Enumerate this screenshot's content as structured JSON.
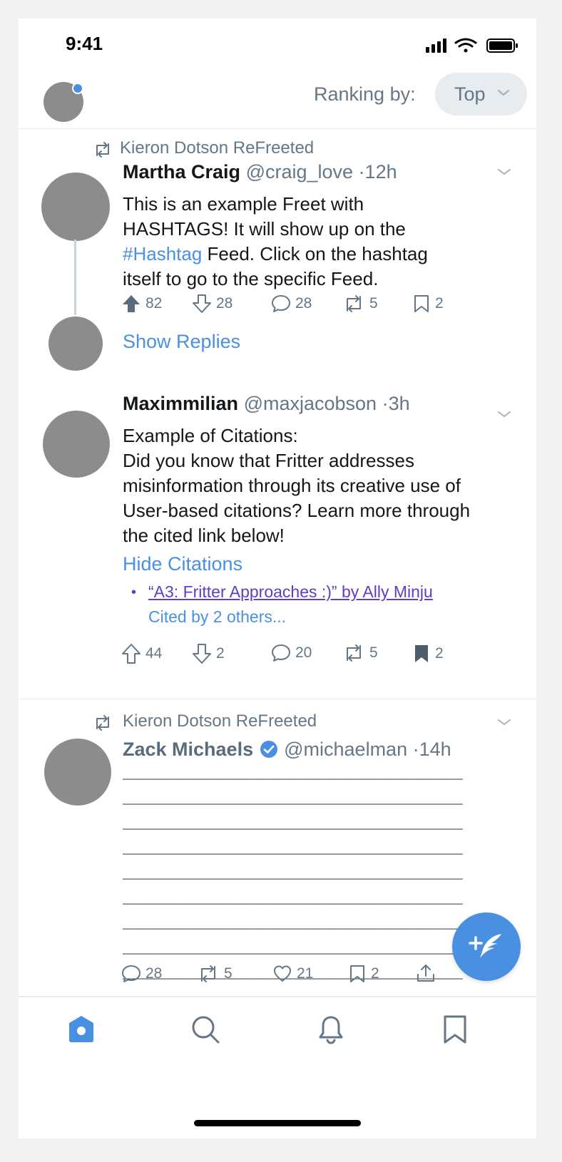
{
  "status_bar": {
    "time": "9:41"
  },
  "header": {
    "ranking_label": "Ranking by:",
    "ranking_value": "Top"
  },
  "posts": [
    {
      "context": "Kieron Dotson ReFreeted",
      "name": "Martha Craig",
      "handle": "@craig_love",
      "time": "·12h",
      "text_lines": [
        "This is an example Freet with",
        "HASHTAGS! It will show up on the"
      ],
      "hashtag": "#Hashtag",
      "text_after_hashtag": " Feed. Click on the hashtag",
      "text_last": "itself to go to the specific Feed.",
      "actions": {
        "upvotes": "82",
        "downvotes": "28",
        "comments": "28",
        "refreets": "5",
        "bookmarks": "2"
      },
      "show_replies": "Show Replies"
    },
    {
      "name": "Maximmilian",
      "handle": "@maxjacobson",
      "time": "·3h",
      "text_lines": [
        "Example of Citations:",
        "Did you know that Fritter addresses",
        "misinformation through its creative use of",
        "User-based citations? Learn more through",
        "the cited link below!"
      ],
      "hide_citations": "Hide Citations",
      "citation": "“A3: Fritter Approaches :)” by Ally Minju",
      "cited_by": "Cited by 2 others...",
      "actions": {
        "upvotes": "44",
        "downvotes": "2",
        "comments": "20",
        "refreets": "5",
        "bookmarks": "2"
      }
    },
    {
      "context": "Kieron Dotson ReFreeted",
      "name": "Zack Michaels",
      "handle": "@michaelman",
      "time": "·14h",
      "dash_lines": [
        "____________________________________",
        "____________________________________",
        "____________________________________",
        "____________________________________",
        "____________________________________",
        "____________________________________",
        "____________________________________",
        "____________________________________",
        "____________________________________"
      ],
      "actions": {
        "comments": "28",
        "refreets": "5",
        "likes": "21",
        "bookmarks": "2"
      }
    }
  ],
  "colors": {
    "accent": "#4a90e2",
    "muted": "#657786",
    "citation": "#5f3dc4"
  }
}
